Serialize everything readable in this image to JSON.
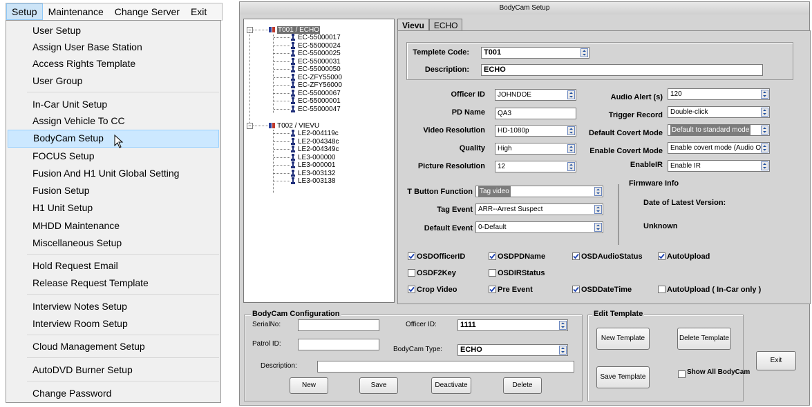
{
  "menubar": {
    "items": [
      "Setup",
      "Maintenance",
      "Change Server",
      "Exit"
    ]
  },
  "menu": {
    "items": [
      "User Setup",
      "Assign User Base Station",
      "Access Rights Template",
      "User Group",
      "In-Car Unit Setup",
      "Assign Vehicle To CC",
      "BodyCam Setup",
      "FOCUS Setup",
      "Fusion And H1 Unit Global Setting",
      "Fusion Setup",
      "H1 Unit Setup",
      "MHDD Maintenance",
      "Miscellaneous Setup",
      "Hold Request Email",
      "Release Request Template",
      "Interview Notes Setup",
      "Interview Room Setup",
      "Cloud Management Setup",
      "AutoDVD Burner Setup",
      "Change Password"
    ],
    "highlighted": "BodyCam Setup"
  },
  "window": {
    "title": "BodyCam Setup"
  },
  "tree": {
    "groups": [
      {
        "label": "T001 / ECHO",
        "children": [
          "EC-55000017",
          "EC-55000024",
          "EC-55000025",
          "EC-55000031",
          "EC-55000050",
          "EC-ZFY55000",
          "EC-ZFY56000",
          "EC-55000067",
          "EC-55000001",
          "EC-55000047"
        ]
      },
      {
        "label": "T002 / VIEVU",
        "children": [
          "LE2-004119c",
          "LE2-004348c",
          "LE2-004349c",
          "LE3-000000",
          "LE3-000001",
          "LE3-003132",
          "LE3-003138"
        ]
      }
    ]
  },
  "tabs": [
    "Vievu",
    "ECHO"
  ],
  "template": {
    "code_label": "Templete Code:",
    "code_value": "T001",
    "desc_label": "Description:",
    "desc_value": "ECHO"
  },
  "fields": {
    "officer_id_label": "Officer ID",
    "officer_id_value": "JOHNDOE",
    "pd_name_label": "PD Name",
    "pd_name_value": "QA3",
    "video_res_label": "Video Resolution",
    "video_res_value": "HD-1080p",
    "quality_label": "Quality",
    "quality_value": "High",
    "picture_res_label": "Picture Resolution",
    "picture_res_value": "12",
    "audio_alert_label": "Audio Alert (s)",
    "audio_alert_value": "120",
    "trigger_record_label": "Trigger Record",
    "trigger_record_value": "Double-click",
    "covert_default_label": "Default Covert Mode",
    "covert_default_value": "Default to standard mode",
    "covert_enable_label": "Enable Covert Mode",
    "covert_enable_value": "Enable covert mode (Audio On",
    "enable_ir_label": "EnableIR",
    "enable_ir_value": "Enable IR",
    "t_button_label": "T Button Function",
    "t_button_value": "Tag video",
    "tag_event_label": "Tag Event",
    "tag_event_value": "ARR--Arrest Suspect",
    "default_event_label": "Default Event",
    "default_event_value": "0-Default"
  },
  "firmware": {
    "title": "Firmware Info",
    "date_label": "Date of Latest Version:",
    "status": "Unknown"
  },
  "checkboxes": [
    {
      "label": "OSDOfficerID",
      "checked": true
    },
    {
      "label": "OSDPDName",
      "checked": true
    },
    {
      "label": "OSDAudioStatus",
      "checked": true
    },
    {
      "label": "AutoUpload",
      "checked": true
    },
    {
      "label": "OSDF2Key",
      "checked": false
    },
    {
      "label": "OSDIRStatus",
      "checked": false
    },
    {
      "label": "Crop Video",
      "checked": true
    },
    {
      "label": "Pre Event",
      "checked": true
    },
    {
      "label": "OSDDateTime",
      "checked": true
    },
    {
      "label": "AutoUpload ( In-Car only )",
      "checked": false
    }
  ],
  "config": {
    "title": "BodyCam Configuration",
    "serial_label": "SerialNo:",
    "serial_value": "",
    "patrol_label": "Patrol ID:",
    "patrol_value": "",
    "desc_label": "Description:",
    "desc_value": "",
    "officer_label": "Officer ID:",
    "officer_value": "1111",
    "type_label": "BodyCam Type:",
    "type_value": "ECHO",
    "btn_new": "New",
    "btn_save": "Save",
    "btn_deactivate": "Deactivate",
    "btn_delete": "Delete"
  },
  "edit_template": {
    "title": "Edit Template",
    "btn_new": "New Template",
    "btn_delete": "Delete Template",
    "btn_save": "Save Template",
    "show_all": "Show All BodyCam",
    "show_all_checked": false
  },
  "exit_label": "Exit"
}
